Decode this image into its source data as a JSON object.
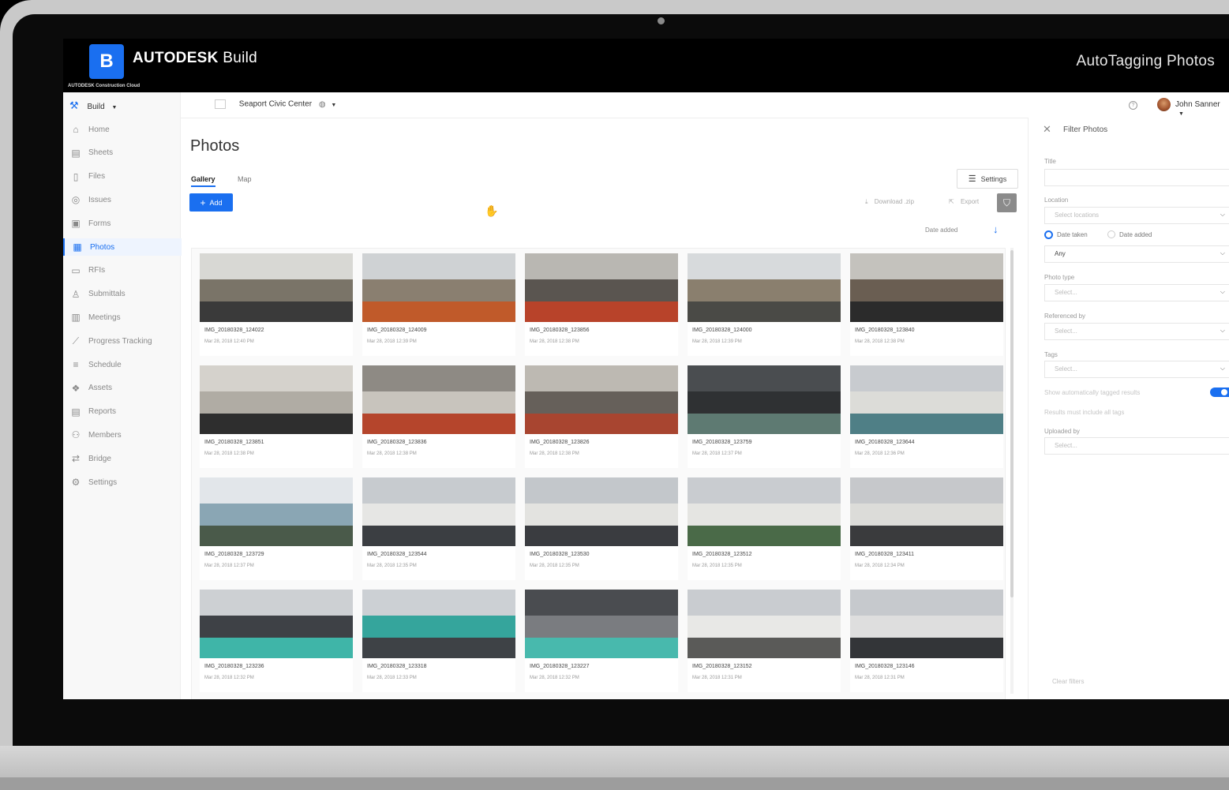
{
  "video": {
    "title": "AutoTagging Photos"
  },
  "header": {
    "logo_letter": "B",
    "brand_bold": "AUTODESK",
    "brand_product": "Build",
    "brand_sub": "AUTODESK Construction Cloud"
  },
  "subbar": {
    "app": "Build",
    "project": "Seaport Civic Center",
    "user": "John Sanner"
  },
  "sidebar": {
    "items": [
      {
        "label": "Home",
        "icon": "home-icon",
        "glyph": "⌂"
      },
      {
        "label": "Sheets",
        "icon": "sheets-icon",
        "glyph": "▤"
      },
      {
        "label": "Files",
        "icon": "files-icon",
        "glyph": "▯"
      },
      {
        "label": "Issues",
        "icon": "issues-icon",
        "glyph": "◎"
      },
      {
        "label": "Forms",
        "icon": "forms-icon",
        "glyph": "▣"
      },
      {
        "label": "Photos",
        "icon": "photos-icon",
        "glyph": "▦"
      },
      {
        "label": "RFIs",
        "icon": "rfis-icon",
        "glyph": "▭"
      },
      {
        "label": "Submittals",
        "icon": "submittals-icon",
        "glyph": "♙"
      },
      {
        "label": "Meetings",
        "icon": "meetings-icon",
        "glyph": "▥"
      },
      {
        "label": "Progress Tracking",
        "icon": "progress-icon",
        "glyph": "⟋"
      },
      {
        "label": "Schedule",
        "icon": "schedule-icon",
        "glyph": "≡"
      },
      {
        "label": "Assets",
        "icon": "assets-icon",
        "glyph": "❖"
      },
      {
        "label": "Reports",
        "icon": "reports-icon",
        "glyph": "▤"
      },
      {
        "label": "Members",
        "icon": "members-icon",
        "glyph": "⚇"
      },
      {
        "label": "Bridge",
        "icon": "bridge-icon",
        "glyph": "⇄"
      },
      {
        "label": "Settings",
        "icon": "gear-icon",
        "glyph": "⚙"
      }
    ],
    "active": "Photos"
  },
  "main": {
    "title": "Photos",
    "tabs": [
      "Gallery",
      "Map"
    ],
    "settings_label": "Settings",
    "add_label": "Add",
    "download_label": "Download .zip",
    "export_label": "Export",
    "sort_label": "Date added"
  },
  "photos": [
    {
      "name": "IMG_20180328_124022",
      "date": "Mar 28, 2018 12:40 PM",
      "colors": [
        "#d8d8d4",
        "#7a7468",
        "#3a3a3a"
      ]
    },
    {
      "name": "IMG_20180328_124009",
      "date": "Mar 28, 2018 12:39 PM",
      "colors": [
        "#cfd2d4",
        "#8a7f70",
        "#c05a2a"
      ]
    },
    {
      "name": "IMG_20180328_123856",
      "date": "Mar 28, 2018 12:38 PM",
      "colors": [
        "#b9b7b2",
        "#5a5550",
        "#b8432a"
      ]
    },
    {
      "name": "IMG_20180328_124000",
      "date": "Mar 28, 2018 12:39 PM",
      "colors": [
        "#d7dadc",
        "#8a7f6e",
        "#4a4a46"
      ]
    },
    {
      "name": "IMG_20180328_123840",
      "date": "Mar 28, 2018 12:38 PM",
      "colors": [
        "#c4c2bd",
        "#6a5e52",
        "#2b2b2b"
      ]
    },
    {
      "name": "IMG_20180328_123851",
      "date": "Mar 28, 2018 12:38 PM",
      "colors": [
        "#d5d2cc",
        "#b0aca4",
        "#2e2e2e"
      ]
    },
    {
      "name": "IMG_20180328_123836",
      "date": "Mar 28, 2018 12:38 PM",
      "colors": [
        "#8e8a84",
        "#c8c4bd",
        "#b5452c"
      ]
    },
    {
      "name": "IMG_20180328_123826",
      "date": "Mar 28, 2018 12:38 PM",
      "colors": [
        "#bdb9b2",
        "#66605a",
        "#a84530"
      ]
    },
    {
      "name": "IMG_20180328_123759",
      "date": "Mar 28, 2018 12:37 PM",
      "colors": [
        "#4a4d50",
        "#2f3133",
        "#5e7a72"
      ]
    },
    {
      "name": "IMG_20180328_123644",
      "date": "Mar 28, 2018 12:36 PM",
      "colors": [
        "#c8cbcf",
        "#dcdcd8",
        "#4f7f86"
      ]
    },
    {
      "name": "IMG_20180328_123729",
      "date": "Mar 28, 2018 12:37 PM",
      "colors": [
        "#e2e6ea",
        "#8aa6b4",
        "#4a5a4a"
      ]
    },
    {
      "name": "IMG_20180328_123544",
      "date": "Mar 28, 2018 12:35 PM",
      "colors": [
        "#c7cbcf",
        "#e6e6e4",
        "#3b3e42"
      ]
    },
    {
      "name": "IMG_20180328_123530",
      "date": "Mar 28, 2018 12:35 PM",
      "colors": [
        "#c3c7cb",
        "#e3e3e0",
        "#3a3c40"
      ]
    },
    {
      "name": "IMG_20180328_123512",
      "date": "Mar 28, 2018 12:35 PM",
      "colors": [
        "#c9ccd0",
        "#e5e5e2",
        "#4a6a48"
      ]
    },
    {
      "name": "IMG_20180328_123411",
      "date": "Mar 28, 2018 12:34 PM",
      "colors": [
        "#c6c8cb",
        "#dcdcd9",
        "#3a3b3d"
      ]
    },
    {
      "name": "IMG_20180328_123236",
      "date": "Mar 28, 2018 12:32 PM",
      "colors": [
        "#cdd0d3",
        "#3e4146",
        "#3fb5a8"
      ]
    },
    {
      "name": "IMG_20180328_123318",
      "date": "Mar 28, 2018 12:33 PM",
      "colors": [
        "#ccd0d4",
        "#35a59c",
        "#3e4246"
      ]
    },
    {
      "name": "IMG_20180328_123227",
      "date": "Mar 28, 2018 12:32 PM",
      "colors": [
        "#4a4c50",
        "#7a7c80",
        "#48b9ad"
      ]
    },
    {
      "name": "IMG_20180328_123152",
      "date": "Mar 28, 2018 12:31 PM",
      "colors": [
        "#c9ccd0",
        "#e8e8e6",
        "#5a5a58"
      ]
    },
    {
      "name": "IMG_20180328_123146",
      "date": "Mar 28, 2018 12:31 PM",
      "colors": [
        "#c6c9cd",
        "#dedede",
        "#333538"
      ]
    }
  ],
  "filter": {
    "title": "Filter Photos",
    "title_label": "Title",
    "location_label": "Location",
    "location_placeholder": "Select locations",
    "radio_taken": "Date taken",
    "radio_added": "Date added",
    "date_value": "Any",
    "photo_type_label": "Photo type",
    "photo_type_placeholder": "Select...",
    "referenced_label": "Referenced by",
    "referenced_placeholder": "Select...",
    "tags_label": "Tags",
    "tags_placeholder": "Select...",
    "auto_tag_label": "Show automatically tagged results",
    "auto_tag_on": true,
    "results_hint": "Results must include all tags",
    "uploaded_label": "Uploaded by",
    "uploaded_placeholder": "Select...",
    "clear_label": "Clear filters"
  },
  "colors": {
    "accent": "#1a6ff0",
    "topbar": "#000000"
  }
}
